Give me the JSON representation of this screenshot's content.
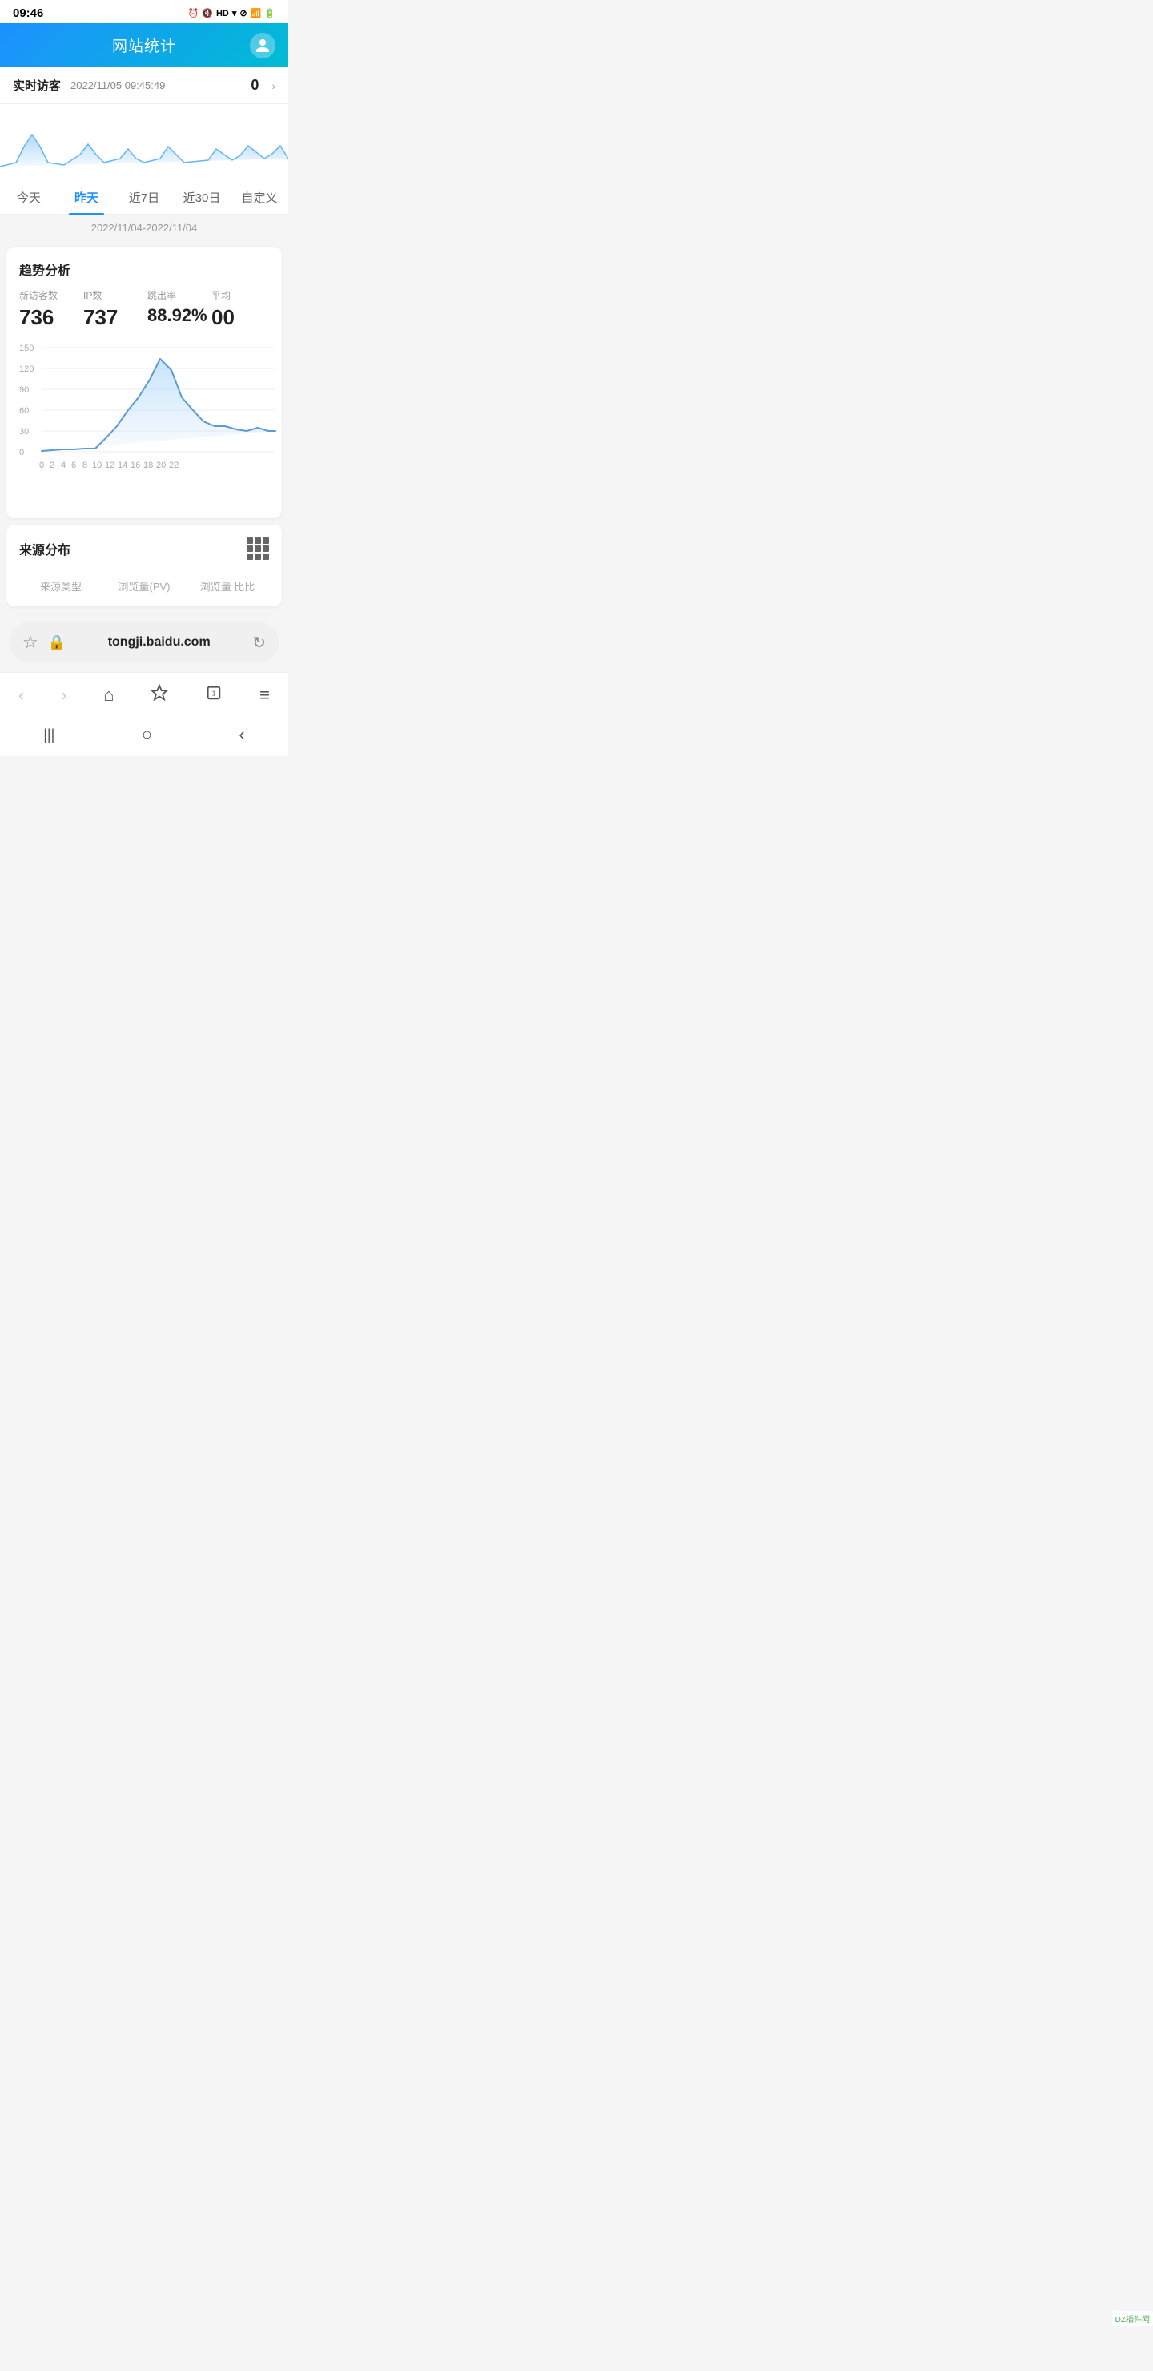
{
  "statusBar": {
    "time": "09:46",
    "icons": "⏰ 🔇 HD ▾ ⊘ 📶 🔋"
  },
  "header": {
    "title": "网站统计",
    "avatarIcon": "person"
  },
  "realtimeVisitor": {
    "label": "实时访客",
    "time": "2022/11/05 09:45:49",
    "count": "0"
  },
  "tabs": [
    {
      "id": "today",
      "label": "今天",
      "active": false
    },
    {
      "id": "yesterday",
      "label": "昨天",
      "active": true
    },
    {
      "id": "7days",
      "label": "近7日",
      "active": false
    },
    {
      "id": "30days",
      "label": "近30日",
      "active": false
    },
    {
      "id": "custom",
      "label": "自定义",
      "active": false
    }
  ],
  "dateRange": "2022/11/04-2022/11/04",
  "trendCard": {
    "title": "趋势分析",
    "stats": [
      {
        "label": "新访客数",
        "value": "736"
      },
      {
        "label": "IP数",
        "value": "737"
      },
      {
        "label": "跳出率",
        "value": "88.92%"
      },
      {
        "label": "平均",
        "value": "00"
      }
    ],
    "chart": {
      "yLabels": [
        "150",
        "120",
        "90",
        "60",
        "30",
        "0"
      ],
      "xLabels": [
        "0",
        "2",
        "4",
        "6",
        "8",
        "10",
        "12",
        "14",
        "16",
        "18",
        "20",
        "22"
      ]
    }
  },
  "sourceCard": {
    "title": "来源分布",
    "columns": [
      "来源类型",
      "浏览量(PV)",
      "浏览量 比比"
    ]
  },
  "urlBar": {
    "url": "tongji.baidu.com"
  },
  "bottomNav": {
    "back": "‹",
    "forward": "›",
    "home": "⌂",
    "star": "☆",
    "tabs": "⬜",
    "menu": "≡"
  },
  "androidNav": {
    "recent": "|||",
    "home": "○",
    "back": "‹"
  },
  "watermark": "DZ插件网"
}
